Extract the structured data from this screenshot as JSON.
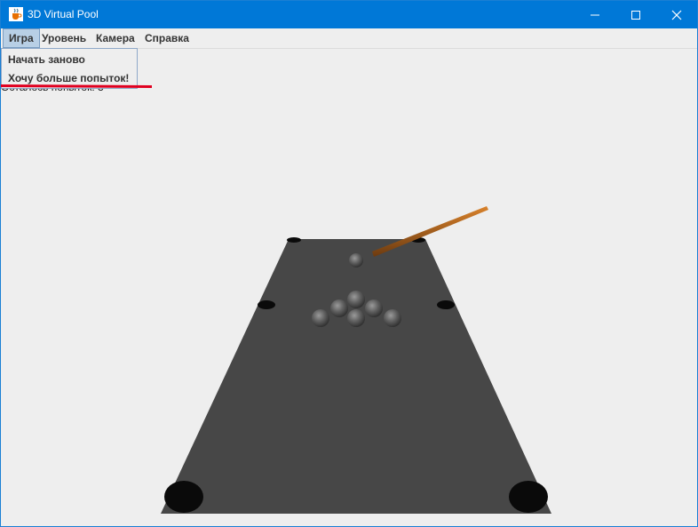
{
  "window": {
    "title": "3D Virtual Pool",
    "icon": "java-cup-icon",
    "controls": [
      "minimize-icon",
      "maximize-icon",
      "close-icon"
    ]
  },
  "menubar": {
    "items": [
      {
        "label": "Игра"
      },
      {
        "label": "Уровень"
      },
      {
        "label": "Камера"
      },
      {
        "label": "Справка"
      }
    ]
  },
  "game_menu": {
    "items": [
      {
        "label": "Начать заново"
      },
      {
        "label": "Хочу больше попыток!"
      }
    ]
  },
  "status": {
    "attempts_text": "Осталось попыток: 3"
  },
  "colors": {
    "titlebar": "#0078d7",
    "table": "#474747",
    "cue": "#b5651d",
    "annotation": "#e00020"
  }
}
